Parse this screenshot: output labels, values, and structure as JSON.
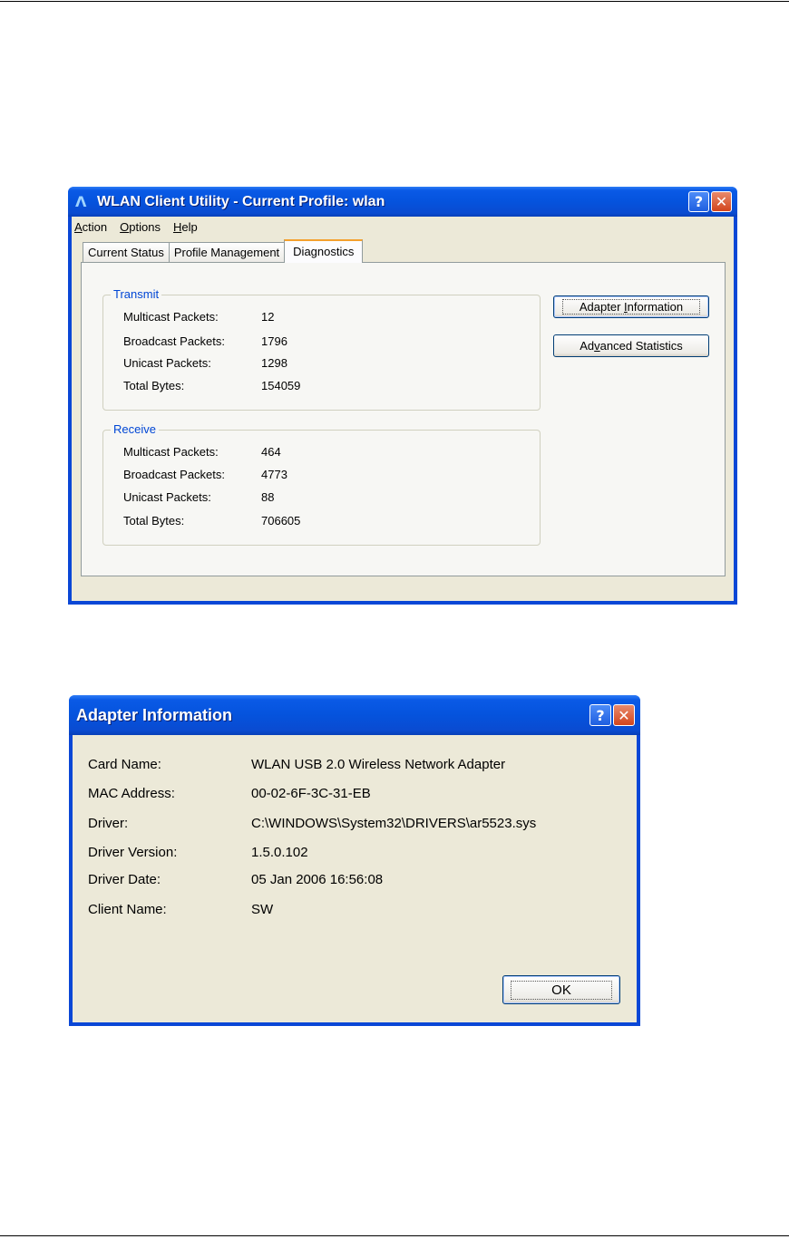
{
  "main_window": {
    "title": "WLAN Client Utility - Current Profile: wlan",
    "title_icon": "Λ",
    "help_button": "?",
    "close_button": "✕",
    "menu": [
      {
        "pre": "",
        "ul": "A",
        "post": "ction"
      },
      {
        "pre": "",
        "ul": "O",
        "post": "ptions"
      },
      {
        "pre": "",
        "ul": "H",
        "post": "elp"
      }
    ],
    "tabs": [
      "Current Status",
      "Profile Management",
      "Diagnostics"
    ],
    "transmit": {
      "title": "Transmit",
      "rows": [
        {
          "label": "Multicast Packets:",
          "value": "12"
        },
        {
          "label": "Broadcast Packets:",
          "value": "1796"
        },
        {
          "label": "Unicast Packets:",
          "value": "1298"
        },
        {
          "label": "Total Bytes:",
          "value": "154059"
        }
      ]
    },
    "receive": {
      "title": "Receive",
      "rows": [
        {
          "label": "Multicast Packets:",
          "value": "464"
        },
        {
          "label": "Broadcast Packets:",
          "value": "4773"
        },
        {
          "label": "Unicast Packets:",
          "value": "88"
        },
        {
          "label": "Total Bytes:",
          "value": "706605"
        }
      ]
    },
    "buttons": {
      "adapter_info": {
        "pre": "Adapter ",
        "ul": "I",
        "post": "nformation"
      },
      "advanced_stats": {
        "pre": "Ad",
        "ul": "v",
        "post": "anced Statistics"
      }
    }
  },
  "adapter_dialog": {
    "title": "Adapter Information",
    "help_button": "?",
    "close_button": "✕",
    "rows": [
      {
        "label": "Card Name:",
        "value": "WLAN USB 2.0 Wireless Network Adapter"
      },
      {
        "label": "MAC Address:",
        "value": "00-02-6F-3C-31-EB"
      },
      {
        "label": "Driver:",
        "value": "C:\\WINDOWS\\System32\\DRIVERS\\ar5523.sys"
      },
      {
        "label": "Driver Version:",
        "value": "1.5.0.102"
      },
      {
        "label": "Driver Date:",
        "value": "05 Jan 2006 16:56:08"
      },
      {
        "label": "Client Name:",
        "value": "SW"
      }
    ],
    "ok_label": "OK"
  },
  "colors": {
    "title_bar": "#0553dd",
    "dialog_bg": "#ece9d8",
    "group_title": "#0046d5",
    "active_tab_accent": "#f4a02d",
    "close_button": "#d3451c"
  }
}
